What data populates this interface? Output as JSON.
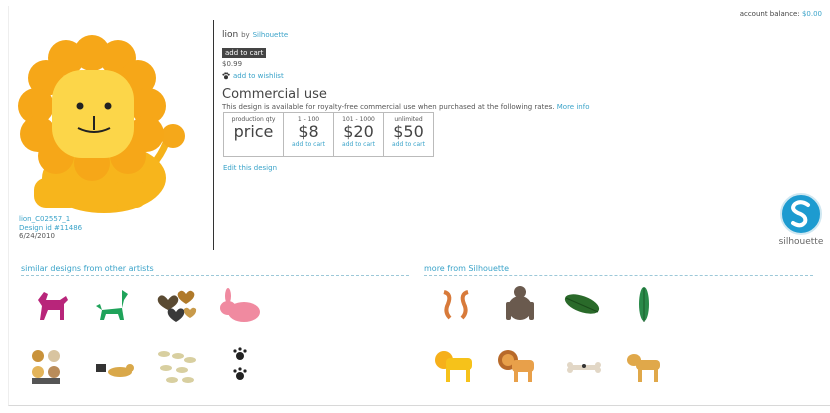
{
  "account": {
    "label": "account balance:",
    "amount": "$0.00"
  },
  "design": {
    "title": "lion",
    "by_label": "by",
    "artist": "Silhouette",
    "add_to_cart": "add to cart",
    "price": "$0.99",
    "wishlist": "add to wishlist",
    "filename": "lion_C02557_1",
    "design_id": "Design id #11486",
    "date": "6/24/2010"
  },
  "commercial": {
    "heading": "Commercial use",
    "description": "This design is available for royalty-free commercial use when purchased at the following rates.",
    "more_info": "More info",
    "header_label": "production qty",
    "header_big": "price",
    "tiers": [
      {
        "qty": "1 - 100",
        "price": "$8",
        "link": "add to cart"
      },
      {
        "qty": "101 - 1000",
        "price": "$20",
        "link": "add to cart"
      },
      {
        "qty": "unlimited",
        "price": "$50",
        "link": "add to cart"
      }
    ],
    "edit": "Edit this design"
  },
  "brand": {
    "word": "silhouette",
    "color": "#1d9bd0"
  },
  "similar": {
    "title": "similar designs from other artists",
    "items": [
      "pink-horse-icon",
      "green-horse-icon",
      "animal-print-hearts-icon",
      "pink-bunny-icon",
      "baby-animals-icon",
      "tiny-dogs-icon",
      "leaf-pattern-icon",
      "paw-prints-icon"
    ]
  },
  "more": {
    "title": "more from Silhouette",
    "items": [
      "seahorses-icon",
      "gorilla-icon",
      "leaf-icon",
      "fern-icon",
      "yellow-lion-icon",
      "brown-lion-icon",
      "bone-icon",
      "lioness-icon"
    ]
  }
}
